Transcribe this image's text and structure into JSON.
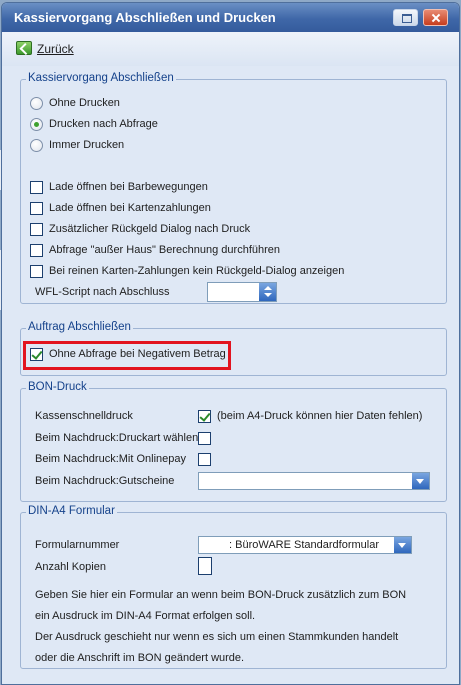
{
  "window": {
    "title": "Kassiervorgang Abschließen und Drucken"
  },
  "toolbar": {
    "back_label": "Zurück"
  },
  "group_close": {
    "title": "Kassiervorgang Abschließen",
    "radios": [
      {
        "label": "Ohne Drucken",
        "checked": false
      },
      {
        "label": "Drucken nach Abfrage",
        "checked": true
      },
      {
        "label": "Immer Drucken",
        "checked": false
      }
    ],
    "checks": [
      {
        "label": "Lade öffnen bei Barbewegungen",
        "checked": false
      },
      {
        "label": "Lade öffnen bei Kartenzahlungen",
        "checked": false
      },
      {
        "label": "Zusätzlicher Rückgeld Dialog nach Druck",
        "checked": false
      },
      {
        "label": "Abfrage \"außer Haus\" Berechnung durchführen",
        "checked": false
      },
      {
        "label": "Bei reinen Karten-Zahlungen kein Rückgeld-Dialog anzeigen",
        "checked": false
      }
    ],
    "wfl_label": "WFL-Script nach Abschluss",
    "wfl_value": ""
  },
  "group_order": {
    "title": "Auftrag Abschließen",
    "check_label": "Ohne Abfrage bei Negativem Betrag",
    "checked": true,
    "highlight_color": "#e2141f"
  },
  "group_bon": {
    "title": "BON-Druck",
    "quick_label": "Kassenschnelldruck",
    "quick_checked": true,
    "quick_note": "(beim A4-Druck können hier Daten fehlen)",
    "reprint_type_label": "Beim Nachdruck:Druckart wählen",
    "reprint_online_label": "Beim Nachdruck:Mit Onlinepay",
    "reprint_voucher_label": "Beim Nachdruck:Gutscheine",
    "reprint_voucher_value": ""
  },
  "group_din": {
    "title": "DIN-A4 Formular",
    "form_no_label": "Formularnummer",
    "form_no_value": ": BüroWARE Standardformular",
    "copies_label": "Anzahl Kopien",
    "copies_value": "",
    "info_lines": [
      "Geben Sie hier ein Formular an wenn beim BON-Druck zusätzlich zum BON",
      "ein Ausdruck im DIN-A4 Format erfolgen soll.",
      "Der Ausdruck geschieht nur wenn es sich um einen Stammkunden handelt",
      "oder die Anschrift im BON geändert wurde."
    ]
  }
}
